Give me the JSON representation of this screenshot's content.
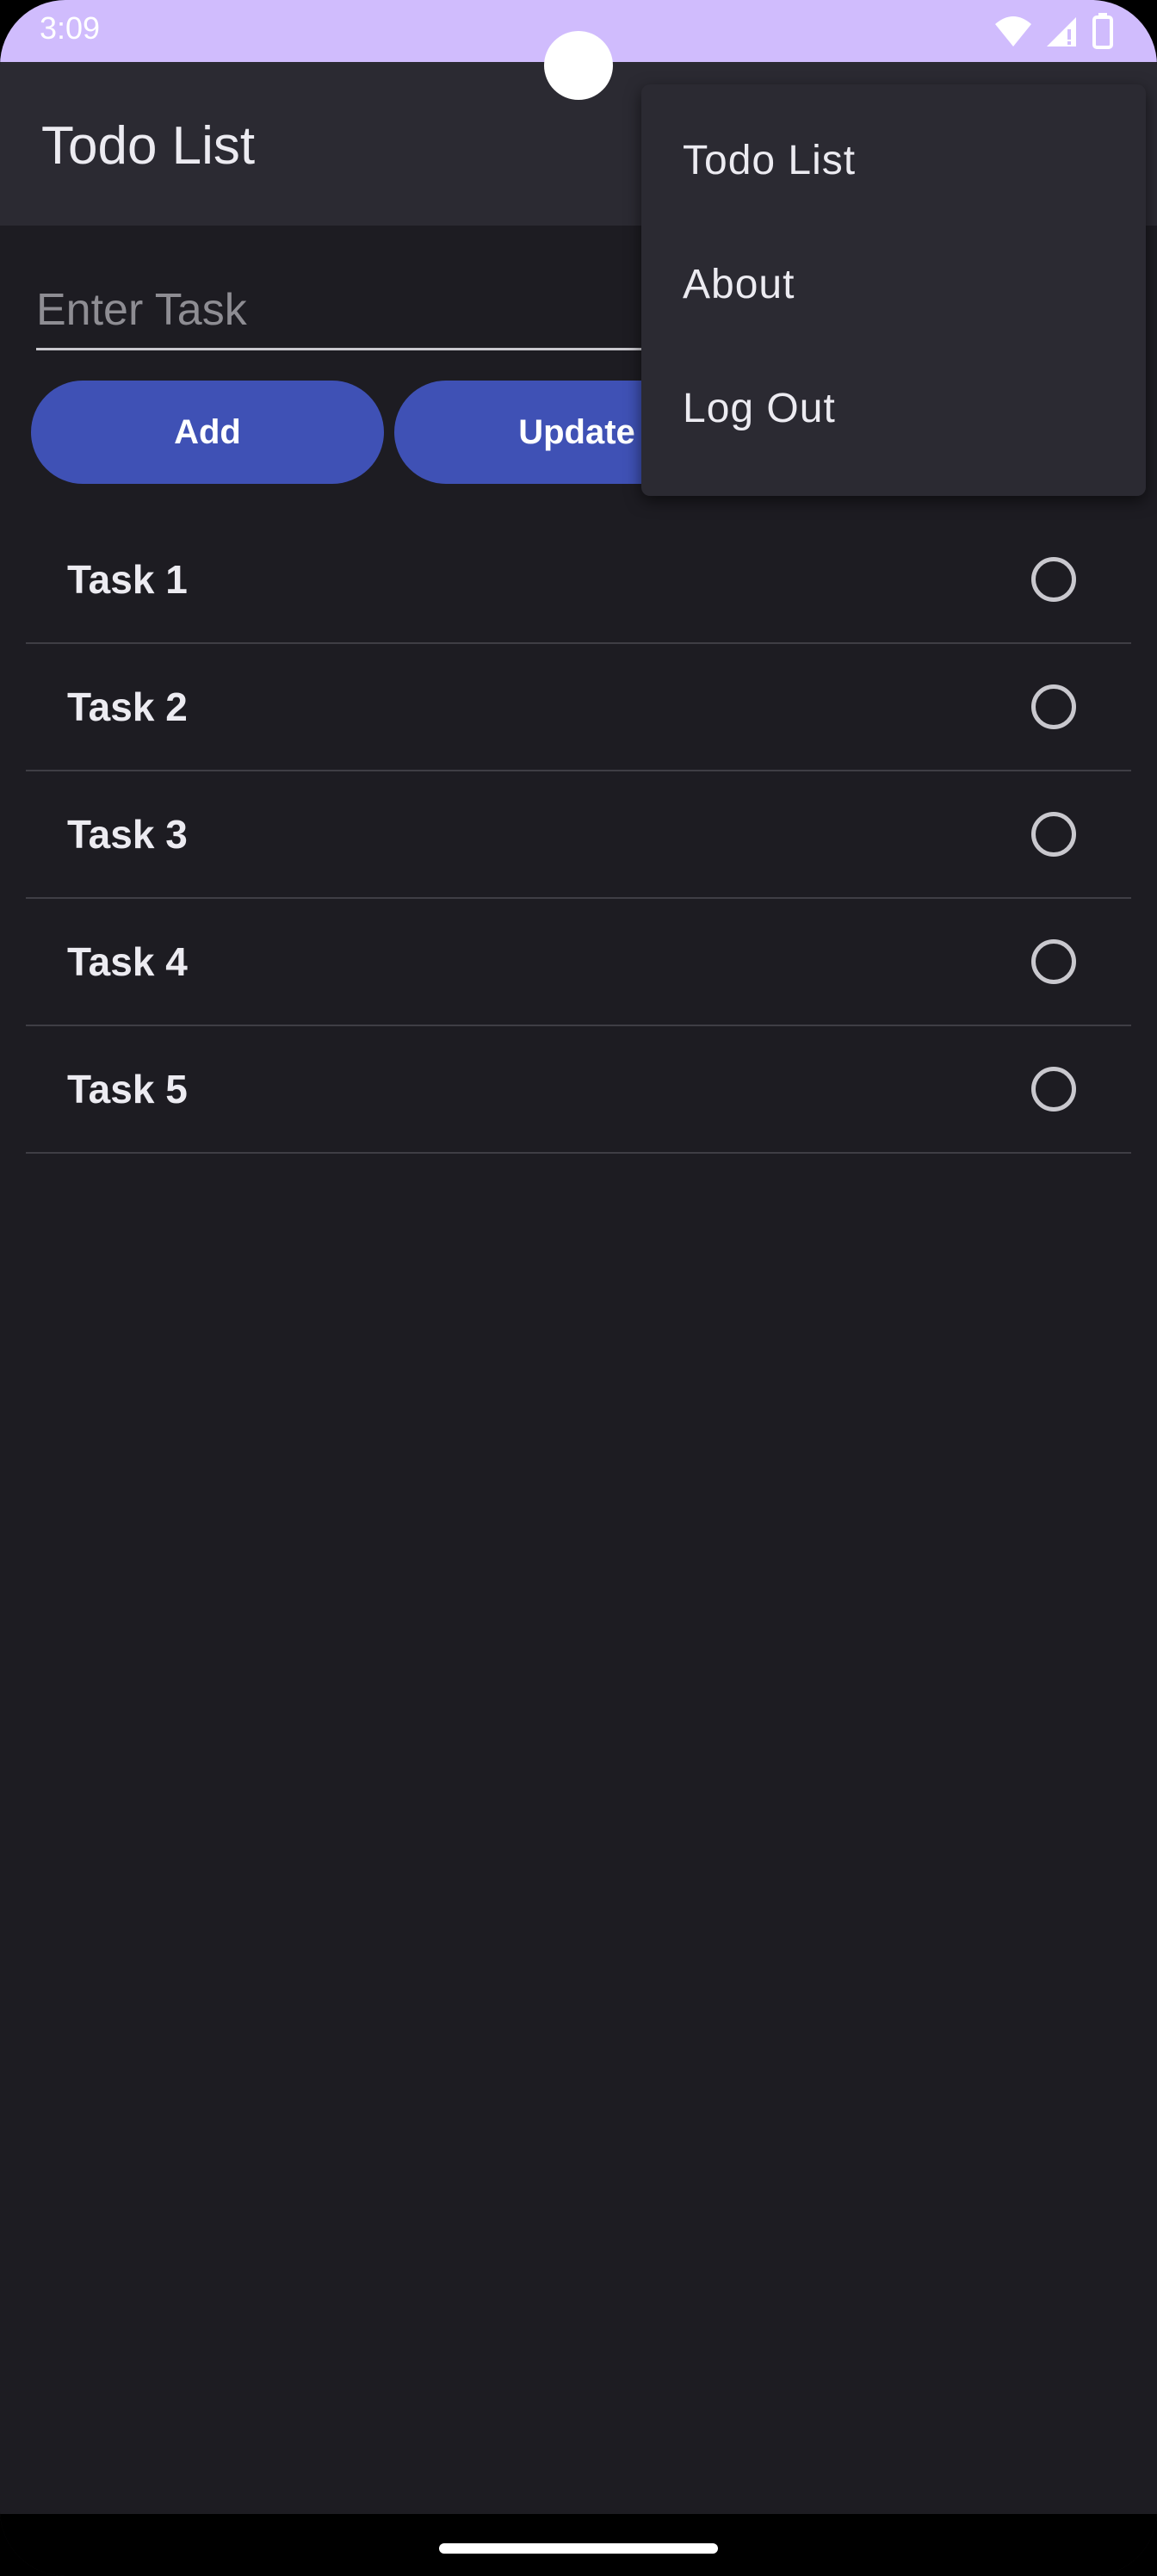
{
  "status_bar": {
    "time": "3:09",
    "background_color": "#d0bcfd",
    "icons": [
      "wifi-icon",
      "cell-signal-icon",
      "battery-icon"
    ]
  },
  "app_bar": {
    "title": "Todo List"
  },
  "task_input": {
    "value": "",
    "placeholder": "Enter Task"
  },
  "buttons": {
    "add_label": "Add",
    "update_label": "Update",
    "accent_color": "#3f51b5"
  },
  "tasks": [
    {
      "label": "Task 1",
      "checked": false
    },
    {
      "label": "Task 2",
      "checked": false
    },
    {
      "label": "Task 3",
      "checked": false
    },
    {
      "label": "Task 4",
      "checked": false
    },
    {
      "label": "Task 5",
      "checked": false
    }
  ],
  "overflow_menu": {
    "items": [
      {
        "label": "Todo List"
      },
      {
        "label": "About"
      },
      {
        "label": "Log Out"
      }
    ]
  }
}
